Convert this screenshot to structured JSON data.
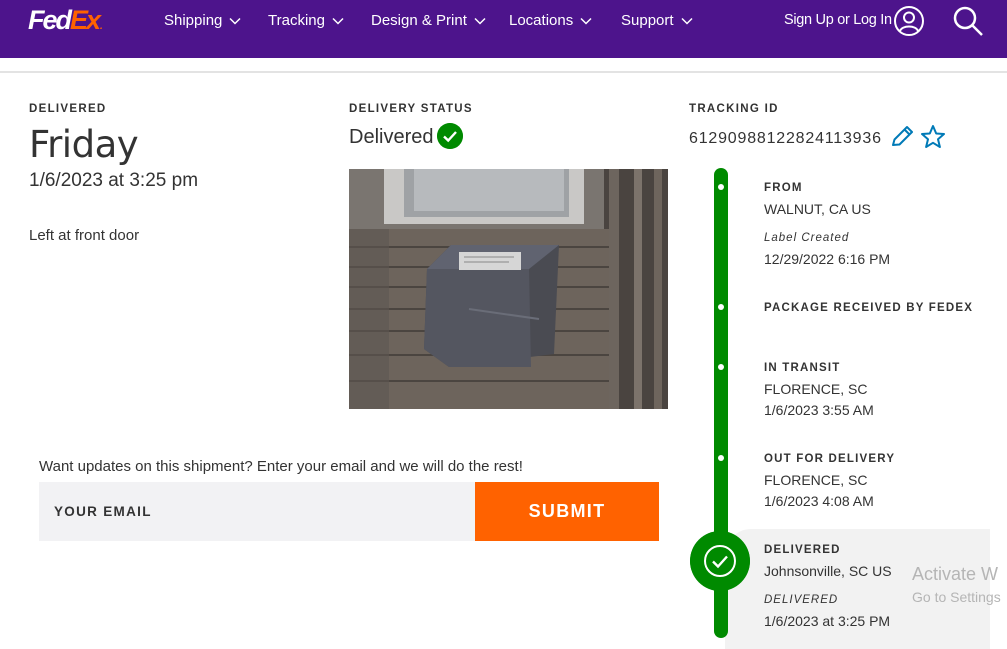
{
  "header": {
    "logo": {
      "fed": "Fed",
      "ex": "Ex",
      "dot": "."
    },
    "nav": [
      {
        "label": "Shipping"
      },
      {
        "label": "Tracking"
      },
      {
        "label": "Design & Print"
      },
      {
        "label": "Locations"
      },
      {
        "label": "Support"
      }
    ],
    "signin_label": "Sign Up or Log In",
    "icons": [
      "user-icon",
      "search-icon",
      "chevron-down-icon"
    ]
  },
  "delivered_section": {
    "heading": "DELIVERED",
    "day": "Friday",
    "datetime": "1/6/2023 at 3:25 pm",
    "note": "Left at front door"
  },
  "status_section": {
    "heading": "DELIVERY STATUS",
    "status": "Delivered",
    "status_icon": "check-circle-icon"
  },
  "tracking_section": {
    "heading": "TRACKING ID",
    "id": "61290988122824113936",
    "icons": [
      "pencil-icon",
      "star-icon"
    ]
  },
  "email_signup": {
    "prompt": "Want updates on this shipment? Enter your email and we will do the rest!",
    "placeholder": "YOUR EMAIL",
    "submit_label": "SUBMIT"
  },
  "timeline": [
    {
      "title": "FROM",
      "location": "WALNUT, CA US",
      "status_label": "Label Created",
      "time": "12/29/2022 6:16 PM"
    },
    {
      "title": "PACKAGE RECEIVED BY FEDEX"
    },
    {
      "title": "IN TRANSIT",
      "location": "FLORENCE, SC",
      "time": "1/6/2023 3:55 AM"
    },
    {
      "title": "OUT FOR DELIVERY",
      "location": "FLORENCE, SC",
      "time": "1/6/2023 4:08 AM"
    },
    {
      "title": "DELIVERED",
      "location": "Johnsonville, SC US",
      "status_label": "DELIVERED",
      "time": "1/6/2023 at 3:25 PM"
    }
  ],
  "watermark": {
    "line1": "Activate W",
    "line2": "Go to Settings"
  },
  "colors": {
    "brand_purple": "#4d148c",
    "brand_orange": "#ff6200",
    "status_green": "#008a00",
    "link_blue": "#007ab7"
  }
}
